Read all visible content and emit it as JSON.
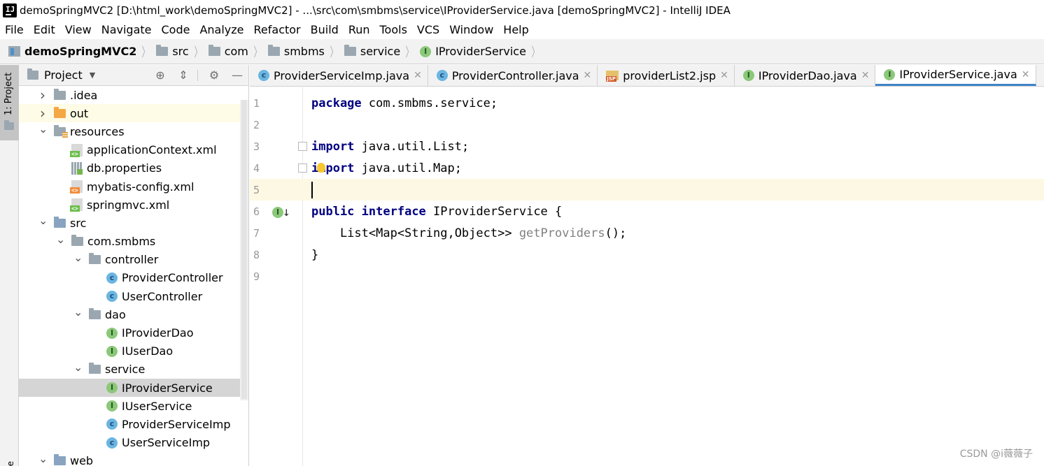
{
  "window": {
    "title": "demoSpringMVC2 [D:\\html_work\\demoSpringMVC2] - ...\\src\\com\\smbms\\service\\IProviderService.java [demoSpringMVC2] - IntelliJ IDEA"
  },
  "app_icon": "IJ",
  "menu": [
    "File",
    "Edit",
    "View",
    "Navigate",
    "Code",
    "Analyze",
    "Refactor",
    "Build",
    "Run",
    "Tools",
    "VCS",
    "Window",
    "Help"
  ],
  "breadcrumbs": [
    {
      "label": "demoSpringMVC2",
      "icon": "module-icon"
    },
    {
      "label": "src",
      "icon": "folder-icon"
    },
    {
      "label": "com",
      "icon": "folder-icon"
    },
    {
      "label": "smbms",
      "icon": "folder-icon"
    },
    {
      "label": "service",
      "icon": "folder-icon"
    },
    {
      "label": "IProviderService",
      "icon": "interface-icon"
    }
  ],
  "sidebar": {
    "strip_label": "1: Project",
    "bottom_label": "e"
  },
  "project_panel": {
    "title": "Project",
    "tree": [
      {
        "label": ".idea",
        "depth": 0,
        "arrow": "collapsed",
        "icon": "folder"
      },
      {
        "label": "out",
        "depth": 0,
        "arrow": "collapsed",
        "icon": "folder-orange"
      },
      {
        "label": "resources",
        "depth": 0,
        "arrow": "expanded",
        "icon": "folder-res"
      },
      {
        "label": "applicationContext.xml",
        "depth": 1,
        "arrow": "none",
        "icon": "spring-xml"
      },
      {
        "label": "db.properties",
        "depth": 1,
        "arrow": "none",
        "icon": "properties"
      },
      {
        "label": "mybatis-config.xml",
        "depth": 1,
        "arrow": "none",
        "icon": "xml"
      },
      {
        "label": "springmvc.xml",
        "depth": 1,
        "arrow": "none",
        "icon": "spring-xml"
      },
      {
        "label": "src",
        "depth": 0,
        "arrow": "expanded",
        "icon": "folder-blue"
      },
      {
        "label": "com.smbms",
        "depth": 1,
        "arrow": "expanded",
        "icon": "package"
      },
      {
        "label": "controller",
        "depth": 2,
        "arrow": "expanded",
        "icon": "package"
      },
      {
        "label": "ProviderController",
        "depth": 3,
        "arrow": "none",
        "icon": "class"
      },
      {
        "label": "UserController",
        "depth": 3,
        "arrow": "none",
        "icon": "class"
      },
      {
        "label": "dao",
        "depth": 2,
        "arrow": "expanded",
        "icon": "package"
      },
      {
        "label": "IProviderDao",
        "depth": 3,
        "arrow": "none",
        "icon": "interface"
      },
      {
        "label": "IUserDao",
        "depth": 3,
        "arrow": "none",
        "icon": "interface"
      },
      {
        "label": "service",
        "depth": 2,
        "arrow": "expanded",
        "icon": "package"
      },
      {
        "label": "IProviderService",
        "depth": 3,
        "arrow": "none",
        "icon": "interface",
        "selected": true
      },
      {
        "label": "IUserService",
        "depth": 3,
        "arrow": "none",
        "icon": "interface"
      },
      {
        "label": "ProviderServiceImp",
        "depth": 3,
        "arrow": "none",
        "icon": "class"
      },
      {
        "label": "UserServiceImp",
        "depth": 3,
        "arrow": "none",
        "icon": "class"
      },
      {
        "label": "web",
        "depth": 0,
        "arrow": "expanded",
        "icon": "folder-blue"
      }
    ]
  },
  "tabs": [
    {
      "label": "ProviderServiceImp.java",
      "icon": "class",
      "active": false
    },
    {
      "label": "ProviderController.java",
      "icon": "class",
      "active": false
    },
    {
      "label": "providerList2.jsp",
      "icon": "jsp",
      "active": false
    },
    {
      "label": "IProviderDao.java",
      "icon": "interface",
      "active": false
    },
    {
      "label": "IProviderService.java",
      "icon": "interface",
      "active": true
    }
  ],
  "editor": {
    "current_line": 5,
    "lines": [
      {
        "n": "1",
        "tokens": [
          {
            "t": "package",
            "c": "kw"
          },
          {
            "t": " com.smbms.service;",
            "c": "plain"
          }
        ]
      },
      {
        "n": "2",
        "tokens": []
      },
      {
        "n": "3",
        "tokens": [
          {
            "t": "import",
            "c": "kw"
          },
          {
            "t": " java.util.List;",
            "c": "plain"
          }
        ]
      },
      {
        "n": "4",
        "tokens": [
          {
            "t": "import",
            "c": "kw"
          },
          {
            "t": " java.util.Map;",
            "c": "plain"
          }
        ]
      },
      {
        "n": "5",
        "tokens": []
      },
      {
        "n": "6",
        "tokens": [
          {
            "t": "public",
            "c": "kw"
          },
          {
            "t": " ",
            "c": "plain"
          },
          {
            "t": "interface",
            "c": "kw"
          },
          {
            "t": " IProviderService {",
            "c": "plain"
          }
        ]
      },
      {
        "n": "7",
        "tokens": [
          {
            "t": "    List<Map<String,Object>> ",
            "c": "plain"
          },
          {
            "t": "getProviders",
            "c": "greyt"
          },
          {
            "t": "();",
            "c": "plain"
          }
        ]
      },
      {
        "n": "8",
        "tokens": [
          {
            "t": "}",
            "c": "plain"
          }
        ]
      },
      {
        "n": "9",
        "tokens": []
      }
    ]
  },
  "watermark": "CSDN @i薇薇子",
  "colors": {
    "keyword": "#000080",
    "selection": "#d5d5d5",
    "current_line": "#fdf8e3",
    "active_tab_underline": "#4083c9",
    "class_icon": "#6bb5e2",
    "interface_icon": "#8bc87a"
  }
}
